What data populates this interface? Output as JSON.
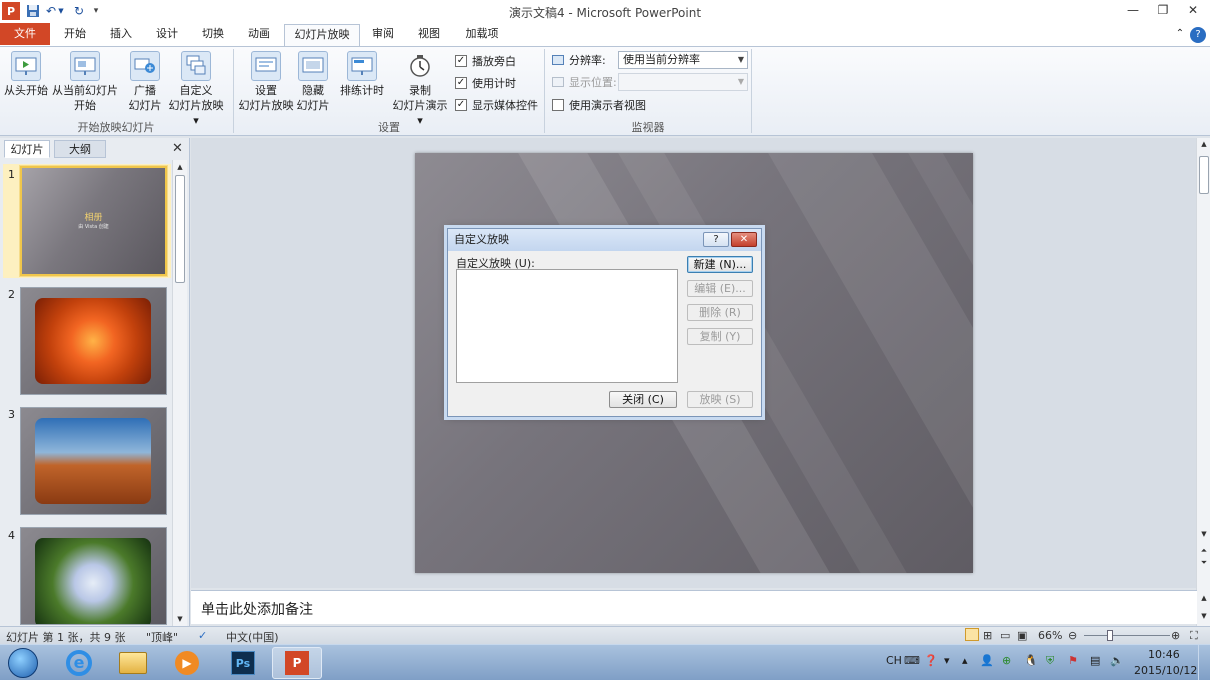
{
  "window": {
    "title": "演示文稿4 - Microsoft PowerPoint",
    "app_icon": "P"
  },
  "tabs": [
    {
      "label": "文件",
      "kind": "file"
    },
    {
      "label": "开始"
    },
    {
      "label": "插入"
    },
    {
      "label": "设计"
    },
    {
      "label": "切换"
    },
    {
      "label": "动画"
    },
    {
      "label": "幻灯片放映",
      "active": true
    },
    {
      "label": "审阅"
    },
    {
      "label": "视图"
    },
    {
      "label": "加载项"
    }
  ],
  "ribbon": {
    "start_group": {
      "label": "开始放映幻灯片",
      "from_start": [
        "从头开始",
        ""
      ],
      "from_current": [
        "从当前幻灯片",
        "开始"
      ],
      "broadcast": [
        "广播",
        "幻灯片"
      ],
      "custom": [
        "自定义",
        "幻灯片放映 ▾"
      ]
    },
    "setup_group": {
      "label": "设置",
      "setup_show": [
        "设置",
        "幻灯片放映"
      ],
      "hide_slide": [
        "隐藏",
        "幻灯片"
      ],
      "rehearse": [
        "排练计时",
        ""
      ],
      "record": [
        "录制",
        "幻灯片演示 ▾"
      ],
      "check_narrations": "播放旁白",
      "check_timings": "使用计时",
      "check_media": "显示媒体控件"
    },
    "monitor_group": {
      "label": "监视器",
      "resolution_label": "分辨率:",
      "resolution_value": "使用当前分辨率",
      "display_label": "显示位置:",
      "display_value": "",
      "presenter_view": "使用演示者视图"
    }
  },
  "left_pane": {
    "tab_slides": "幻灯片",
    "tab_outline": "大纲",
    "slides": [
      {
        "num": "1",
        "title": "相册",
        "subtitle": "由 Vista 创建"
      },
      {
        "num": "2"
      },
      {
        "num": "3"
      },
      {
        "num": "4"
      }
    ]
  },
  "dialog": {
    "title": "自定义放映",
    "help_btn": "?",
    "close_x": "✕",
    "list_label": "自定义放映 (U):",
    "btn_new": "新建 (N)...",
    "btn_edit": "编辑 (E)...",
    "btn_delete": "删除 (R)",
    "btn_copy": "复制 (Y)",
    "btn_close": "关闭 (C)",
    "btn_show": "放映 (S)"
  },
  "notes": {
    "placeholder": "单击此处添加备注"
  },
  "status": {
    "slide_info": "幻灯片 第 1 张，共 9 张",
    "theme": "\"顶峰\"",
    "language": "中文(中国)",
    "zoom": "66%"
  },
  "taskbar": {
    "lang": "CH",
    "time": "10:46",
    "date": "2015/10/12"
  },
  "colors": {
    "file_tab": "#d24726",
    "ribbon_bg": "#e9eef5",
    "taskbar": "#7f9fc6"
  }
}
